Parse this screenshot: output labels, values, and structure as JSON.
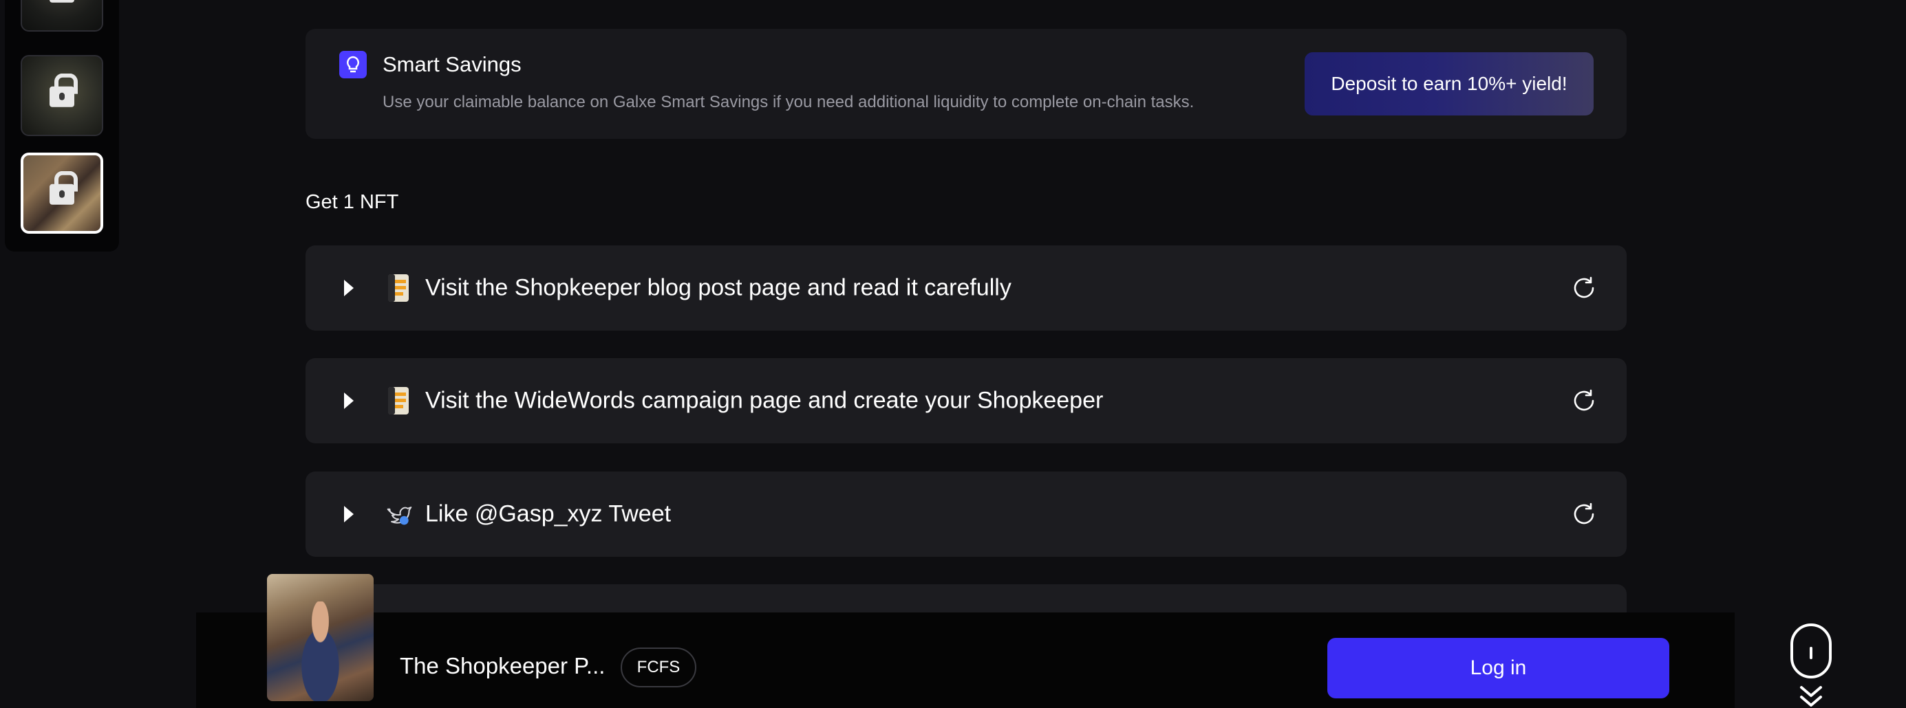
{
  "thumbnails": [
    {
      "locked": true,
      "selected": false
    },
    {
      "locked": true,
      "selected": false
    },
    {
      "locked": true,
      "selected": true
    }
  ],
  "savings": {
    "icon": "lightbulb-icon",
    "title": "Smart Savings",
    "description": "Use your claimable balance on Galxe Smart Savings if you need additional liquidity to complete on-chain tasks.",
    "button_label": "Deposit to earn 10%+ yield!"
  },
  "section": {
    "heading": "Get 1 NFT"
  },
  "tasks": [
    {
      "label": "Visit the Shopkeeper blog post page and read it carefully",
      "icon": "document-icon"
    },
    {
      "label": "Visit the WideWords campaign page and create your Shopkeeper",
      "icon": "document-icon"
    },
    {
      "label": "Like @Gasp_xyz Tweet",
      "icon": "twitter-icon"
    }
  ],
  "bottom_bar": {
    "campaign_title": "The Shopkeeper P...",
    "badge": "FCFS",
    "login_label": "Log in"
  },
  "colors": {
    "background": "#0e0e11",
    "card": "#1c1c20",
    "accent": "#3b2cf5",
    "savings_icon": "#4b3bff"
  }
}
